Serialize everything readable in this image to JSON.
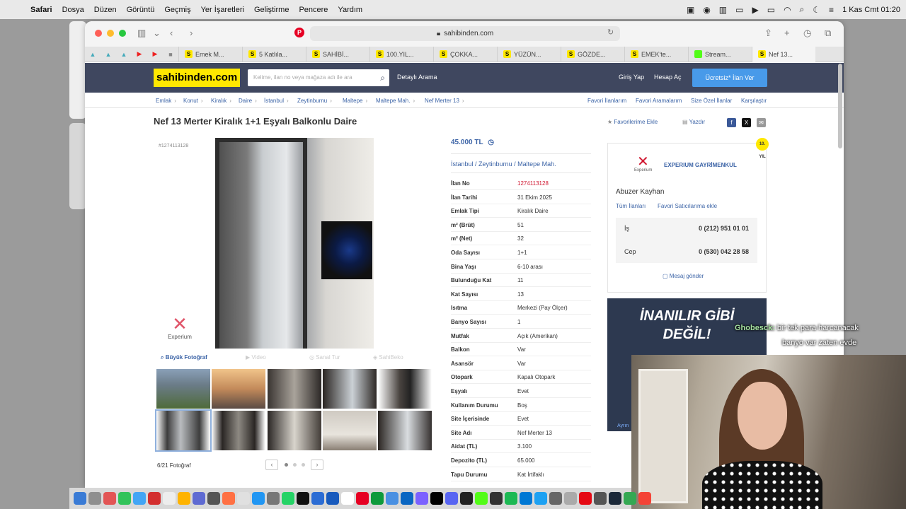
{
  "menubar": {
    "app": "Safari",
    "items": [
      "Dosya",
      "Düzen",
      "Görüntü",
      "Geçmiş",
      "Yer İşaretleri",
      "Geliştirme",
      "Pencere",
      "Yardım"
    ],
    "clock": "1 Kas Cmt  01:20"
  },
  "browser": {
    "url": "sahibinden.com",
    "tabs": [
      "Emek M...",
      "5 Katlıla...",
      "SAHİBİ...",
      "100.YIL...",
      "ÇOKKA...",
      "YÜZÜN...",
      "GÖZDE...",
      "EMEK'te...",
      "Stream...",
      "Nef 13..."
    ]
  },
  "site": {
    "logo": "sahibinden.com",
    "search_placeholder": "Kelime, ilan no veya mağaza adı ile ara",
    "detailed_search": "Detaylı Arama",
    "login": "Giriş Yap",
    "signup": "Hesap Aç",
    "post_ad": "Ücretsiz* İlan Ver"
  },
  "breadcrumbs": [
    "Emlak",
    "Konut",
    "Kiralık",
    "Daire",
    "İstanbul",
    "Zeytinburnu",
    "Maltepe",
    "Maltepe Mah.",
    "Nef Merter 13"
  ],
  "top_links": [
    "Favori İlanlarım",
    "Favori Aramalarım",
    "Size Özel İlanlar",
    "Karşılaştır"
  ],
  "listing": {
    "title": "Nef 13 Merter Kiralık 1+1 Eşyalı Balkonlu Daire",
    "add_favorite": "Favorilerime Ekle",
    "print": "Yazdır",
    "id_watermark": "#1274113128",
    "price": "45.000 TL",
    "location": [
      "İstanbul",
      "Zeytinburnu",
      "Maltepe Mah."
    ],
    "details": [
      {
        "k": "İlan No",
        "v": "1274113128"
      },
      {
        "k": "İlan Tarihi",
        "v": "31 Ekim 2025"
      },
      {
        "k": "Emlak Tipi",
        "v": "Kiralık Daire"
      },
      {
        "k": "m² (Brüt)",
        "v": "51"
      },
      {
        "k": "m² (Net)",
        "v": "32"
      },
      {
        "k": "Oda Sayısı",
        "v": "1+1"
      },
      {
        "k": "Bina Yaşı",
        "v": "6-10 arası"
      },
      {
        "k": "Bulunduğu Kat",
        "v": "11"
      },
      {
        "k": "Kat Sayısı",
        "v": "13"
      },
      {
        "k": "Isıtma",
        "v": "Merkezi (Pay Ölçer)"
      },
      {
        "k": "Banyo Sayısı",
        "v": "1"
      },
      {
        "k": "Mutfak",
        "v": "Açık (Amerikan)"
      },
      {
        "k": "Balkon",
        "v": "Var"
      },
      {
        "k": "Asansör",
        "v": "Var"
      },
      {
        "k": "Otopark",
        "v": "Kapalı Otopark"
      },
      {
        "k": "Eşyalı",
        "v": "Evet"
      },
      {
        "k": "Kullanım Durumu",
        "v": "Boş"
      },
      {
        "k": "Site İçerisinde",
        "v": "Evet"
      },
      {
        "k": "Site Adı",
        "v": "Nef Merter 13"
      },
      {
        "k": "Aidat (TL)",
        "v": "3.100"
      },
      {
        "k": "Depozito (TL)",
        "v": "65.000"
      },
      {
        "k": "Tapu Durumu",
        "v": "Kat İrtifaklı"
      }
    ],
    "gallery": {
      "tabs": [
        "Büyük Fotoğraf",
        "Video",
        "Sanal Tur",
        "SahiBeko"
      ],
      "count": "6/21 Fotoğraf",
      "logo_text": "Experium"
    }
  },
  "seller": {
    "badge": "10. YIL",
    "logo_sub": "Experium",
    "agency": "EXPERIUM GAYRİMENKUL",
    "agent": "Abuzer Kayhan",
    "all_ads": "Tüm İlanları",
    "fav_seller": "Favori Satıcılarıma ekle",
    "phones": [
      {
        "k": "İş",
        "v": "0 (212) 951 01 01"
      },
      {
        "k": "Cep",
        "v": "0 (530) 042 28 58"
      }
    ],
    "message": "Mesaj gönder"
  },
  "ad": {
    "text_line1": "İNANILIR GİBİ",
    "text_line2": "DEĞİL!",
    "link": "Ayrın"
  },
  "stream_chat": {
    "user": "Ghobesck:",
    "line1": "bir tek para harcanacak",
    "line2": "banyo var zaten evde"
  },
  "colors": {
    "brand_yellow": "#ffe800",
    "header_bg": "#3f475f",
    "link_blue": "#3b63a6",
    "cta_blue": "#489ae9",
    "listing_no_red": "#d0162f"
  }
}
